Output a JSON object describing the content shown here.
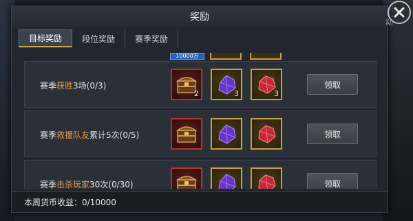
{
  "window": {
    "title": "奖励",
    "close_label": "动"
  },
  "tabs": [
    {
      "label": "目标奖励",
      "active": true
    },
    {
      "label": "段位奖励",
      "active": false
    },
    {
      "label": "赛季奖励",
      "active": false
    }
  ],
  "peek_row": {
    "badge_text": "10000万"
  },
  "rows": [
    {
      "prefix": "赛季",
      "highlight": "获胜",
      "suffix": "3场(0/3)",
      "rewards": [
        {
          "icon": "treasure-chest-icon",
          "qty": "2",
          "frame": "red"
        },
        {
          "icon": "purple-crystal-icon",
          "qty": "3",
          "frame": "gold"
        },
        {
          "icon": "red-crystal-icon",
          "qty": "3",
          "frame": "gold"
        }
      ],
      "button": "领取"
    },
    {
      "prefix": "赛季",
      "highlight": "救援队友",
      "suffix": "累计5次(0/5)",
      "rewards": [
        {
          "icon": "treasure-chest-icon",
          "qty": "",
          "frame": "red"
        },
        {
          "icon": "purple-crystal-icon",
          "qty": "",
          "frame": "gold"
        },
        {
          "icon": "red-crystal-icon",
          "qty": "",
          "frame": "gold"
        }
      ],
      "button": "领取"
    },
    {
      "prefix": "赛季",
      "highlight": "击杀玩家",
      "suffix": "30次(0/30)",
      "rewards": [
        {
          "icon": "treasure-chest-icon",
          "qty": "",
          "frame": "red"
        },
        {
          "icon": "purple-crystal-icon",
          "qty": "",
          "frame": "gold"
        },
        {
          "icon": "red-crystal-icon",
          "qty": "",
          "frame": "gold"
        }
      ],
      "button": "领取"
    }
  ],
  "footer": {
    "text": "本周货币收益：0/10000"
  },
  "colors": {
    "highlight": "#e59a4f",
    "red_frame": "#b8322d",
    "gold_frame": "#c9a042",
    "tab_underline": "#c9a84e"
  }
}
